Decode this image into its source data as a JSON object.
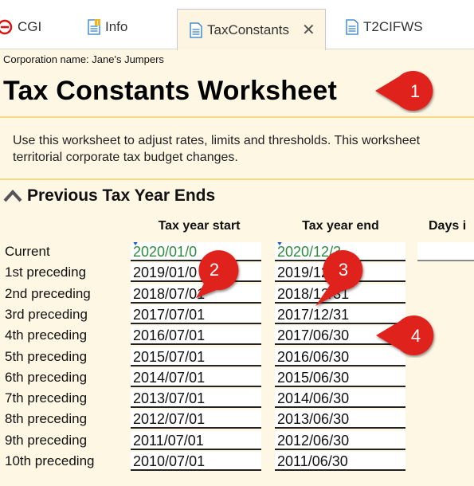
{
  "tabs": [
    {
      "label": "CGI",
      "icon": "error-icon"
    },
    {
      "label": "Info",
      "icon": "document-warning-icon"
    },
    {
      "label": "TaxConstants",
      "icon": "document-icon",
      "active": true
    },
    {
      "label": "T2CIFWS",
      "icon": "document-icon"
    }
  ],
  "header": {
    "corporation": "Corporation name: Jane's Jumpers",
    "title": "Tax Constants Worksheet"
  },
  "description": "Use this worksheet to adjust rates, limits and thresholds. This worksheet\nterritorial corporate tax budget changes.",
  "section": {
    "title": "Previous Tax Year Ends"
  },
  "columns": {
    "start": "Tax year start",
    "end": "Tax year end",
    "days": "Days i"
  },
  "rows": [
    {
      "label": "Current",
      "start": "2020/01/0",
      "end": "2020/12/3"
    },
    {
      "label": "1st preceding",
      "start": "2019/01/0",
      "end": "2019/12/31"
    },
    {
      "label": "2nd preceding",
      "start": "2018/07/01",
      "end": "2018/12/31"
    },
    {
      "label": "3rd preceding",
      "start": "2017/07/01",
      "end": "2017/12/31"
    },
    {
      "label": "4th preceding",
      "start": "2016/07/01",
      "end": "2017/06/30"
    },
    {
      "label": "5th preceding",
      "start": "2015/07/01",
      "end": "2016/06/30"
    },
    {
      "label": "6th preceding",
      "start": "2014/07/01",
      "end": "2015/06/30"
    },
    {
      "label": "7th preceding",
      "start": "2013/07/01",
      "end": "2014/06/30"
    },
    {
      "label": "8th preceding",
      "start": "2012/07/01",
      "end": "2013/06/30"
    },
    {
      "label": "9th preceding",
      "start": "2011/07/01",
      "end": "2012/06/30"
    },
    {
      "label": "10th preceding",
      "start": "2010/07/01",
      "end": "2011/06/30"
    }
  ],
  "callouts": [
    "1",
    "2",
    "3",
    "4"
  ],
  "colors": {
    "callout": "#e0201f",
    "accent_green": "#2e8a3c",
    "separator": "#f5d783",
    "background": "#fef7e4"
  }
}
